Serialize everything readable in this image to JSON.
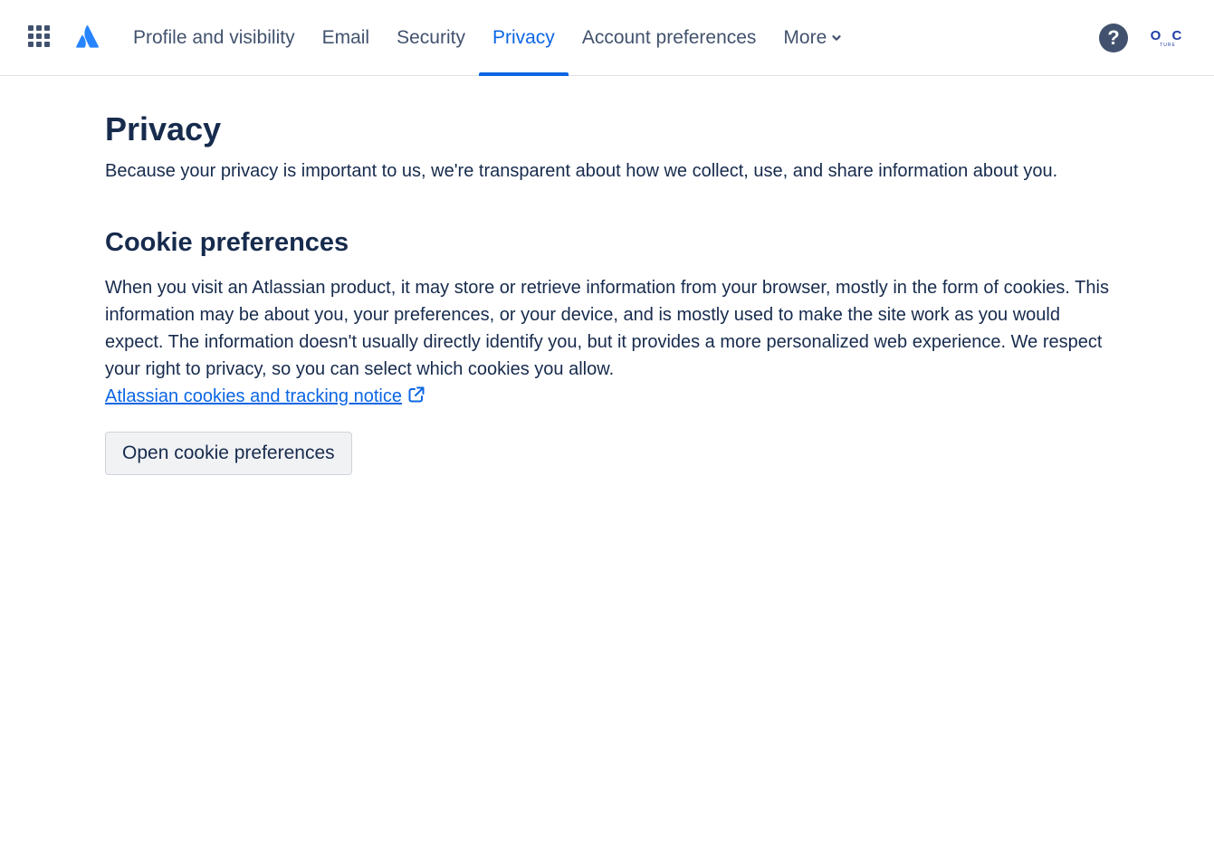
{
  "nav": {
    "tabs": [
      {
        "label": "Profile and visibility"
      },
      {
        "label": "Email"
      },
      {
        "label": "Security"
      },
      {
        "label": "Privacy"
      },
      {
        "label": "Account preferences"
      },
      {
        "label": "More"
      }
    ],
    "active_tab": "Privacy",
    "help_label": "?",
    "avatar_text": "O C",
    "avatar_subtext": "TURE"
  },
  "main": {
    "title": "Privacy",
    "intro": "Because your privacy is important to us, we're transparent about how we collect, use, and share information about you.",
    "cookie_section": {
      "title": "Cookie preferences",
      "body": "When you visit an Atlassian product, it may store or retrieve information from your browser, mostly in the form of cookies. This information may be about you, your preferences, or your device, and is mostly used to make the site work as you would expect. The information doesn't usually directly identify you, but it provides a more personalized web experience. We respect your right to privacy, so you can select which cookies you allow.",
      "link_label": "Atlassian cookies and tracking notice",
      "button_label": "Open cookie preferences"
    }
  },
  "colors": {
    "accent": "#0c66e4",
    "text": "#172b4d",
    "nav_text": "#42526e",
    "logo": "#2684ff"
  },
  "icons": [
    "app-switcher-icon",
    "atlassian-logo-icon",
    "chevron-down-icon",
    "help-icon",
    "external-link-icon"
  ]
}
